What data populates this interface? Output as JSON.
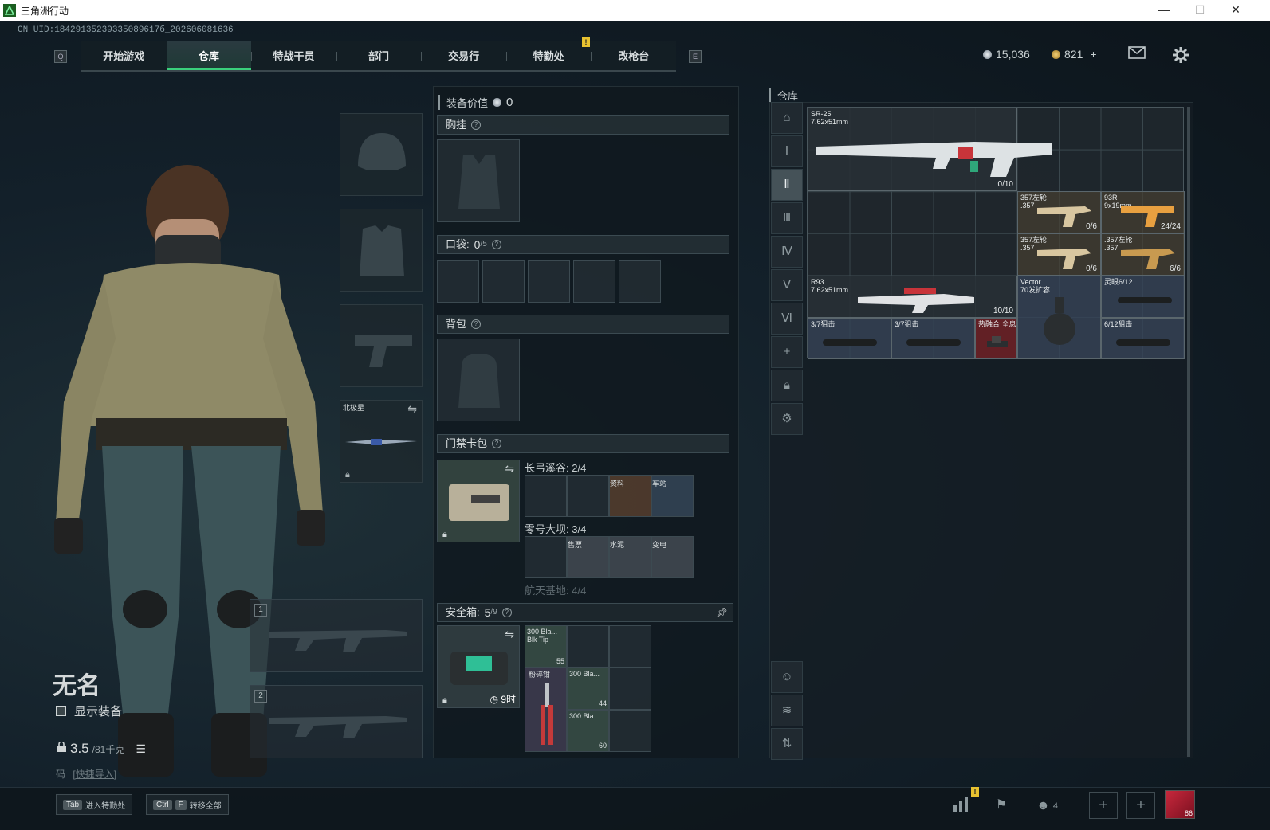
{
  "window": {
    "title": "三角洲行动"
  },
  "uid": "CN UID:18429135239335089617б_202606081636",
  "nav": {
    "left_key": "Q",
    "right_key": "E",
    "tabs": [
      "开始游戏",
      "仓库",
      "特战干员",
      "部门",
      "交易行",
      "特勤处",
      "改枪台"
    ],
    "active": "仓库",
    "alert": "!"
  },
  "currency": {
    "silver": "15,036",
    "gold": "821",
    "gold_add": "+"
  },
  "icons": {
    "mail": "mail-icon",
    "settings": "gear-icon"
  },
  "player": {
    "name": "无名",
    "show_equipment": "显示装备",
    "weight": "3.5",
    "weight_max": "/81千克",
    "code": "码",
    "quick_import": "[快捷导入]"
  },
  "slots": {
    "melee_name": "北极星",
    "gun1": "1",
    "gun2": "2"
  },
  "loadout": {
    "value_label": "装备价值",
    "value": "0",
    "chest": "胸挂",
    "pockets": "口袋:",
    "pockets_count": "0",
    "pockets_max": "/5",
    "backpack": "背包",
    "keycard": "门禁卡包",
    "map1": "长弓溪谷: 2/4",
    "map1_items": [
      "",
      "",
      "资料",
      "车站"
    ],
    "map2": "零号大坝: 3/4",
    "map2_items": [
      "",
      "售票",
      "水泥",
      "变电"
    ],
    "map3": "航天基地: 4/4",
    "safe": "安全箱:",
    "safe_count": "5",
    "safe_max": "/9",
    "safe_timer": "9时",
    "safe_items": [
      {
        "name": "300 Bla...\nBlk Tip",
        "count": "55"
      },
      {
        "name": "300 Bla...",
        "count": "44"
      },
      {
        "name": "300 Bla...",
        "count": "60"
      },
      {
        "name": "粉碎钳",
        "count": ""
      }
    ]
  },
  "storage": {
    "title": "仓库",
    "add": "+",
    "items": [
      {
        "name": "SR-25\n7.62x51mm",
        "count": "0/10"
      },
      {
        "name": "357左轮\n.357",
        "count": "0/6"
      },
      {
        "name": "93R\n9x19mm",
        "count": "24/24"
      },
      {
        "name": "357左轮\n.357",
        "count": "0/6"
      },
      {
        "name": ".357左轮\n.357",
        "count": "6/6"
      },
      {
        "name": "R93\n7.62x51mm",
        "count": "10/10"
      },
      {
        "name": "Vector\n70发扩容",
        "count": ""
      },
      {
        "name": "灵眼6/12",
        "count": ""
      },
      {
        "name": "3/7狙击",
        "count": ""
      },
      {
        "name": "3/7狙击",
        "count": ""
      },
      {
        "name": "热融合 全息",
        "count": ""
      },
      {
        "name": "6/12狙击",
        "count": ""
      }
    ]
  },
  "bottom": {
    "tab_key": "Tab",
    "tab_label": "进入特勤处",
    "ctrl_key": "Ctrl",
    "f_key": "F",
    "transfer_label": "转移全部",
    "alert": "!",
    "team_count": "4",
    "avatar_badge": "86"
  }
}
